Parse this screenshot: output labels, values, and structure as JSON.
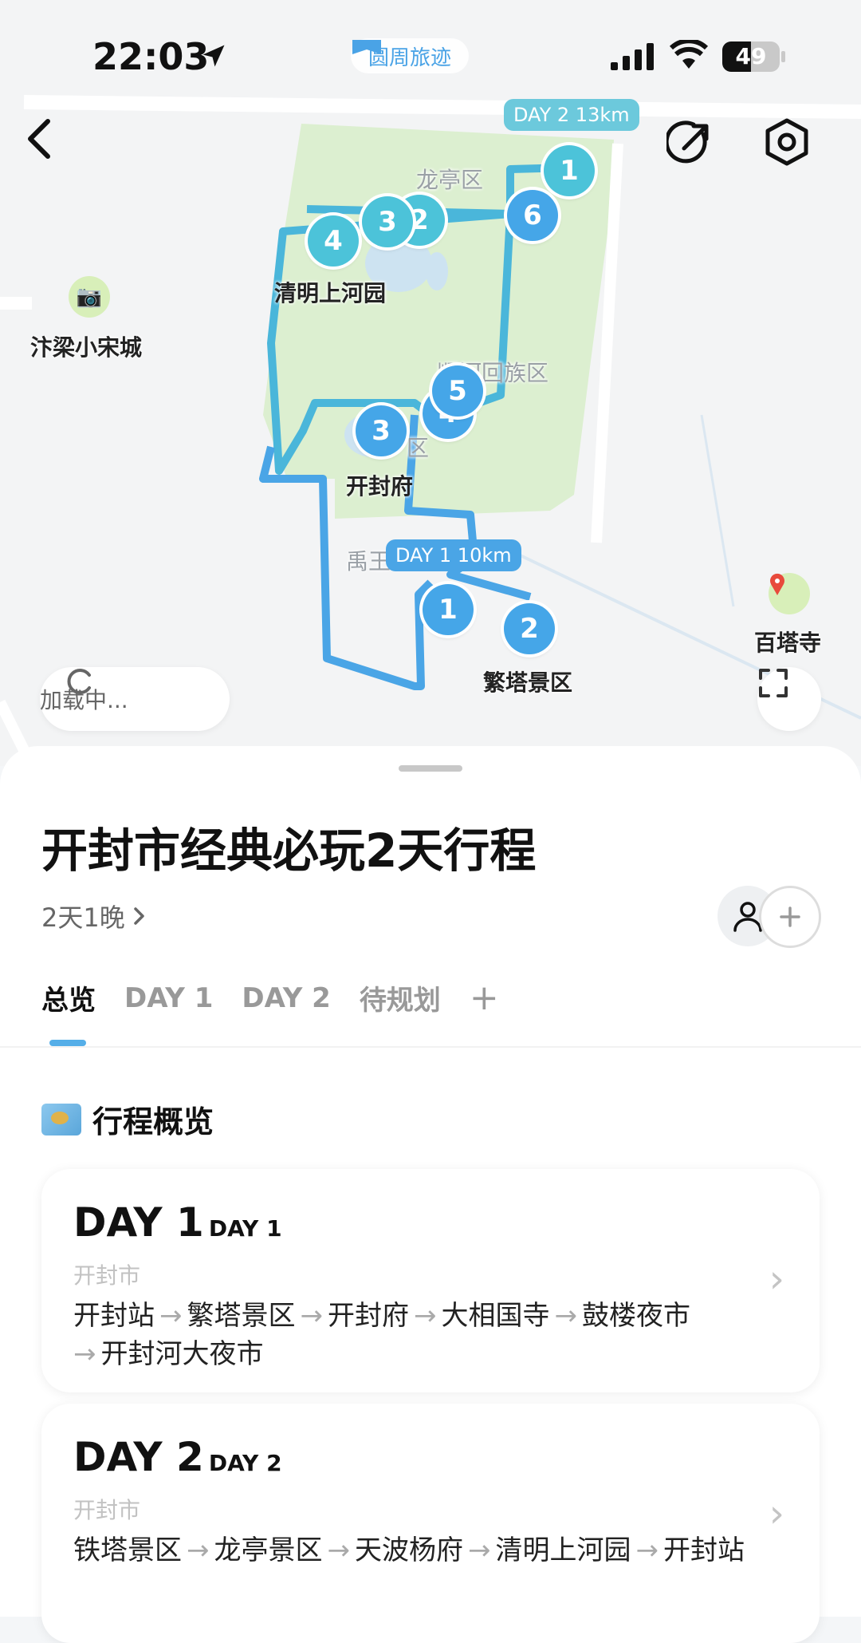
{
  "status_bar": {
    "time": "22:03",
    "app_chip": "圆周旅迹",
    "battery": "49"
  },
  "map": {
    "labels": {
      "longting": "龙亭区",
      "qingming": "清明上河园",
      "bianliang": "汴梁小宋城",
      "huizu": "顺河回族区",
      "kaifengfu": "开封府",
      "district": "区",
      "yuwang": "禹王",
      "fanta": "繁塔景区",
      "baita": "百塔寺"
    },
    "day2_tag": "DAY 2 13km",
    "day1_tag": "DAY 1 10km",
    "day1_pins": [
      "1",
      "2",
      "3",
      "4",
      "5"
    ],
    "day2_pins": [
      "1",
      "2",
      "3",
      "4",
      "6"
    ],
    "loading_text": "加载中..."
  },
  "sheet": {
    "title": "开封市经典必玩2天行程",
    "duration": "2天1晚",
    "tabs": [
      "总览",
      "DAY 1",
      "DAY 2",
      "待规划"
    ],
    "add_tab": "+",
    "overview_heading": "行程概览",
    "days": [
      {
        "big": "DAY 1",
        "small": "DAY 1",
        "city": "开封市",
        "route": [
          "开封站",
          "繁塔景区",
          "开封府",
          "大相国寺",
          "鼓楼夜市",
          "开封河大夜市"
        ]
      },
      {
        "big": "DAY 2",
        "small": "DAY 2",
        "city": "开封市",
        "route": [
          "铁塔景区",
          "龙亭景区",
          "天波杨府",
          "清明上河园",
          "开封站"
        ]
      }
    ]
  },
  "colors": {
    "accent": "#55aee8",
    "day1": "#45a6e8",
    "day2": "#4cc3d9",
    "park": "#dcefd0"
  }
}
